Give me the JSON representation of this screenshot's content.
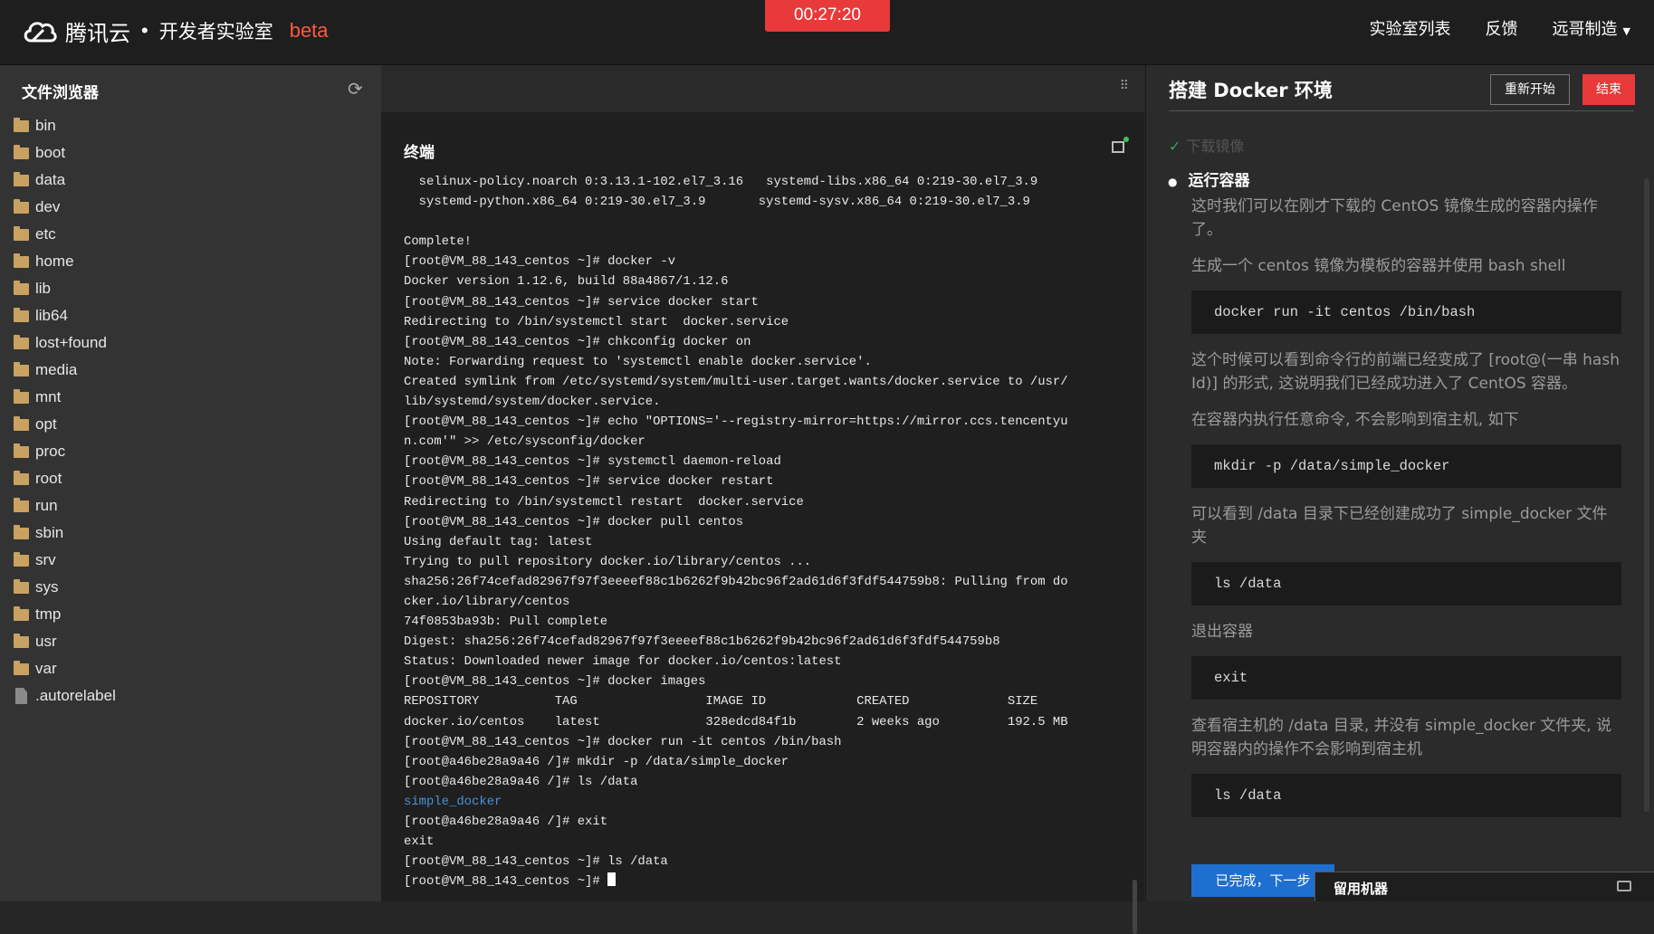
{
  "header": {
    "brand": "腾讯云",
    "separator": "•",
    "lab": "开发者实验室",
    "beta": "beta",
    "timer": "00:27:20",
    "nav": [
      "实验室列表",
      "反馈",
      "远哥制造"
    ],
    "nav_caret": "▼"
  },
  "file_browser": {
    "title": "文件浏览器",
    "refresh_icon": "⟳",
    "items": [
      {
        "name": "bin",
        "type": "folder"
      },
      {
        "name": "boot",
        "type": "folder"
      },
      {
        "name": "data",
        "type": "folder"
      },
      {
        "name": "dev",
        "type": "folder"
      },
      {
        "name": "etc",
        "type": "folder"
      },
      {
        "name": "home",
        "type": "folder"
      },
      {
        "name": "lib",
        "type": "folder"
      },
      {
        "name": "lib64",
        "type": "folder"
      },
      {
        "name": "lost+found",
        "type": "folder"
      },
      {
        "name": "media",
        "type": "folder"
      },
      {
        "name": "mnt",
        "type": "folder"
      },
      {
        "name": "opt",
        "type": "folder"
      },
      {
        "name": "proc",
        "type": "folder"
      },
      {
        "name": "root",
        "type": "folder"
      },
      {
        "name": "run",
        "type": "folder"
      },
      {
        "name": "sbin",
        "type": "folder"
      },
      {
        "name": "srv",
        "type": "folder"
      },
      {
        "name": "sys",
        "type": "folder"
      },
      {
        "name": "tmp",
        "type": "folder"
      },
      {
        "name": "usr",
        "type": "folder"
      },
      {
        "name": "var",
        "type": "folder"
      },
      {
        "name": ".autorelabel",
        "type": "file"
      }
    ]
  },
  "terminal": {
    "grip_icon": "⠿",
    "title": "终端",
    "lines": [
      "  selinux-policy.noarch 0:3.13.1-102.el7_3.16   systemd-libs.x86_64 0:219-30.el7_3.9",
      "  systemd-python.x86_64 0:219-30.el7_3.9       systemd-sysv.x86_64 0:219-30.el7_3.9",
      "",
      "Complete!",
      "[root@VM_88_143_centos ~]# docker -v",
      "Docker version 1.12.6, build 88a4867/1.12.6",
      "[root@VM_88_143_centos ~]# service docker start",
      "Redirecting to /bin/systemctl start  docker.service",
      "[root@VM_88_143_centos ~]# chkconfig docker on",
      "Note: Forwarding request to 'systemctl enable docker.service'.",
      "Created symlink from /etc/systemd/system/multi-user.target.wants/docker.service to /usr/",
      "lib/systemd/system/docker.service.",
      "[root@VM_88_143_centos ~]# echo \"OPTIONS='--registry-mirror=https://mirror.ccs.tencentyu",
      "n.com'\" >> /etc/sysconfig/docker",
      "[root@VM_88_143_centos ~]# systemctl daemon-reload",
      "[root@VM_88_143_centos ~]# service docker restart",
      "Redirecting to /bin/systemctl restart  docker.service",
      "[root@VM_88_143_centos ~]# docker pull centos",
      "Using default tag: latest",
      "Trying to pull repository docker.io/library/centos ...",
      "sha256:26f74cefad82967f97f3eeeef88c1b6262f9b42bc96f2ad61d6f3fdf544759b8: Pulling from do",
      "cker.io/library/centos",
      "74f0853ba93b: Pull complete",
      "Digest: sha256:26f74cefad82967f97f3eeeef88c1b6262f9b42bc96f2ad61d6f3fdf544759b8",
      "Status: Downloaded newer image for docker.io/centos:latest",
      "[root@VM_88_143_centos ~]# docker images",
      "REPOSITORY          TAG                 IMAGE ID            CREATED             SIZE",
      "docker.io/centos    latest              328edcd84f1b        2 weeks ago         192.5 MB",
      "[root@VM_88_143_centos ~]# docker run -it centos /bin/bash",
      "[root@a46be28a9a46 /]# mkdir -p /data/simple_docker",
      "[root@a46be28a9a46 /]# ls /data",
      "simple_docker",
      "[root@a46be28a9a46 /]# exit",
      "exit",
      "[root@VM_88_143_centos ~]# ls /data",
      "[root@VM_88_143_centos ~]# "
    ],
    "highlight_line": 31
  },
  "tutorial": {
    "title": "搭建 Docker 环境",
    "restart_label": "重新开始",
    "end_label": "结束",
    "done_step": "下载镜像",
    "current_step": "运行容器",
    "blocks": [
      {
        "type": "p",
        "text": "这时我们可以在刚才下载的 CentOS 镜像生成的容器内操作了。"
      },
      {
        "type": "p",
        "text": "生成一个 centos 镜像为模板的容器并使用 bash shell"
      },
      {
        "type": "code",
        "text": "docker run -it centos /bin/bash"
      },
      {
        "type": "p",
        "text": "这个时候可以看到命令行的前端已经变成了 [root@(一串 hash Id)] 的形式, 这说明我们已经成功进入了 CentOS 容器。"
      },
      {
        "type": "p",
        "text": "在容器内执行任意命令, 不会影响到宿主机, 如下"
      },
      {
        "type": "code",
        "text": "mkdir -p /data/simple_docker"
      },
      {
        "type": "p",
        "text": "可以看到 /data 目录下已经创建成功了 simple_docker 文件夹"
      },
      {
        "type": "code",
        "text": "ls /data"
      },
      {
        "type": "p",
        "text": "退出容器"
      },
      {
        "type": "code",
        "text": "exit"
      },
      {
        "type": "p",
        "text": "查看宿主机的 /data 目录, 并没有 simple_docker 文件夹, 说明容器内的操作不会影响到宿主机"
      },
      {
        "type": "code",
        "text": "ls /data"
      }
    ],
    "next_label": "已完成，下一步",
    "keep_machine_label": "留用机器"
  }
}
